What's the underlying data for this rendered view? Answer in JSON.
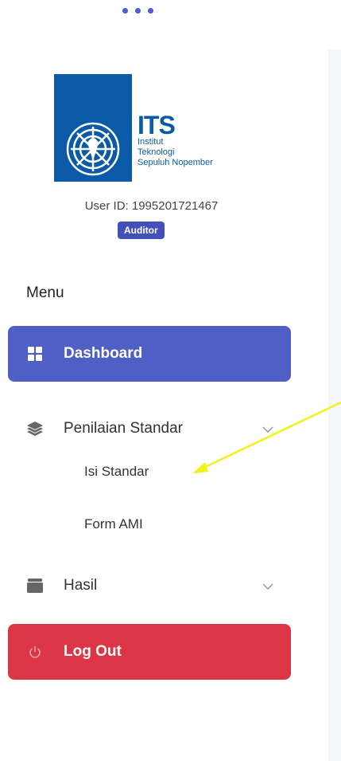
{
  "brand": {
    "short": "ITS",
    "line1": "Institut",
    "line2": "Teknologi",
    "line3": "Sepuluh Nopember"
  },
  "user": {
    "id_label": "User ID: 1995201721467",
    "role": "Auditor"
  },
  "menu": {
    "title": "Menu",
    "dashboard": "Dashboard",
    "penilaian": "Penilaian Standar",
    "isi_standar": "Isi Standar",
    "form_ami": "Form AMI",
    "hasil": "Hasil",
    "logout": "Log Out"
  },
  "icons": {
    "dashboard": "grid-icon",
    "penilaian": "layers-icon",
    "hasil": "archive-icon",
    "logout": "power-icon",
    "expand": "chevron-down-icon"
  },
  "colors": {
    "primary": "#4f5fc5",
    "danger": "#dc3545",
    "brand": "#0a5aa8",
    "annotation": "#f2f21a"
  }
}
